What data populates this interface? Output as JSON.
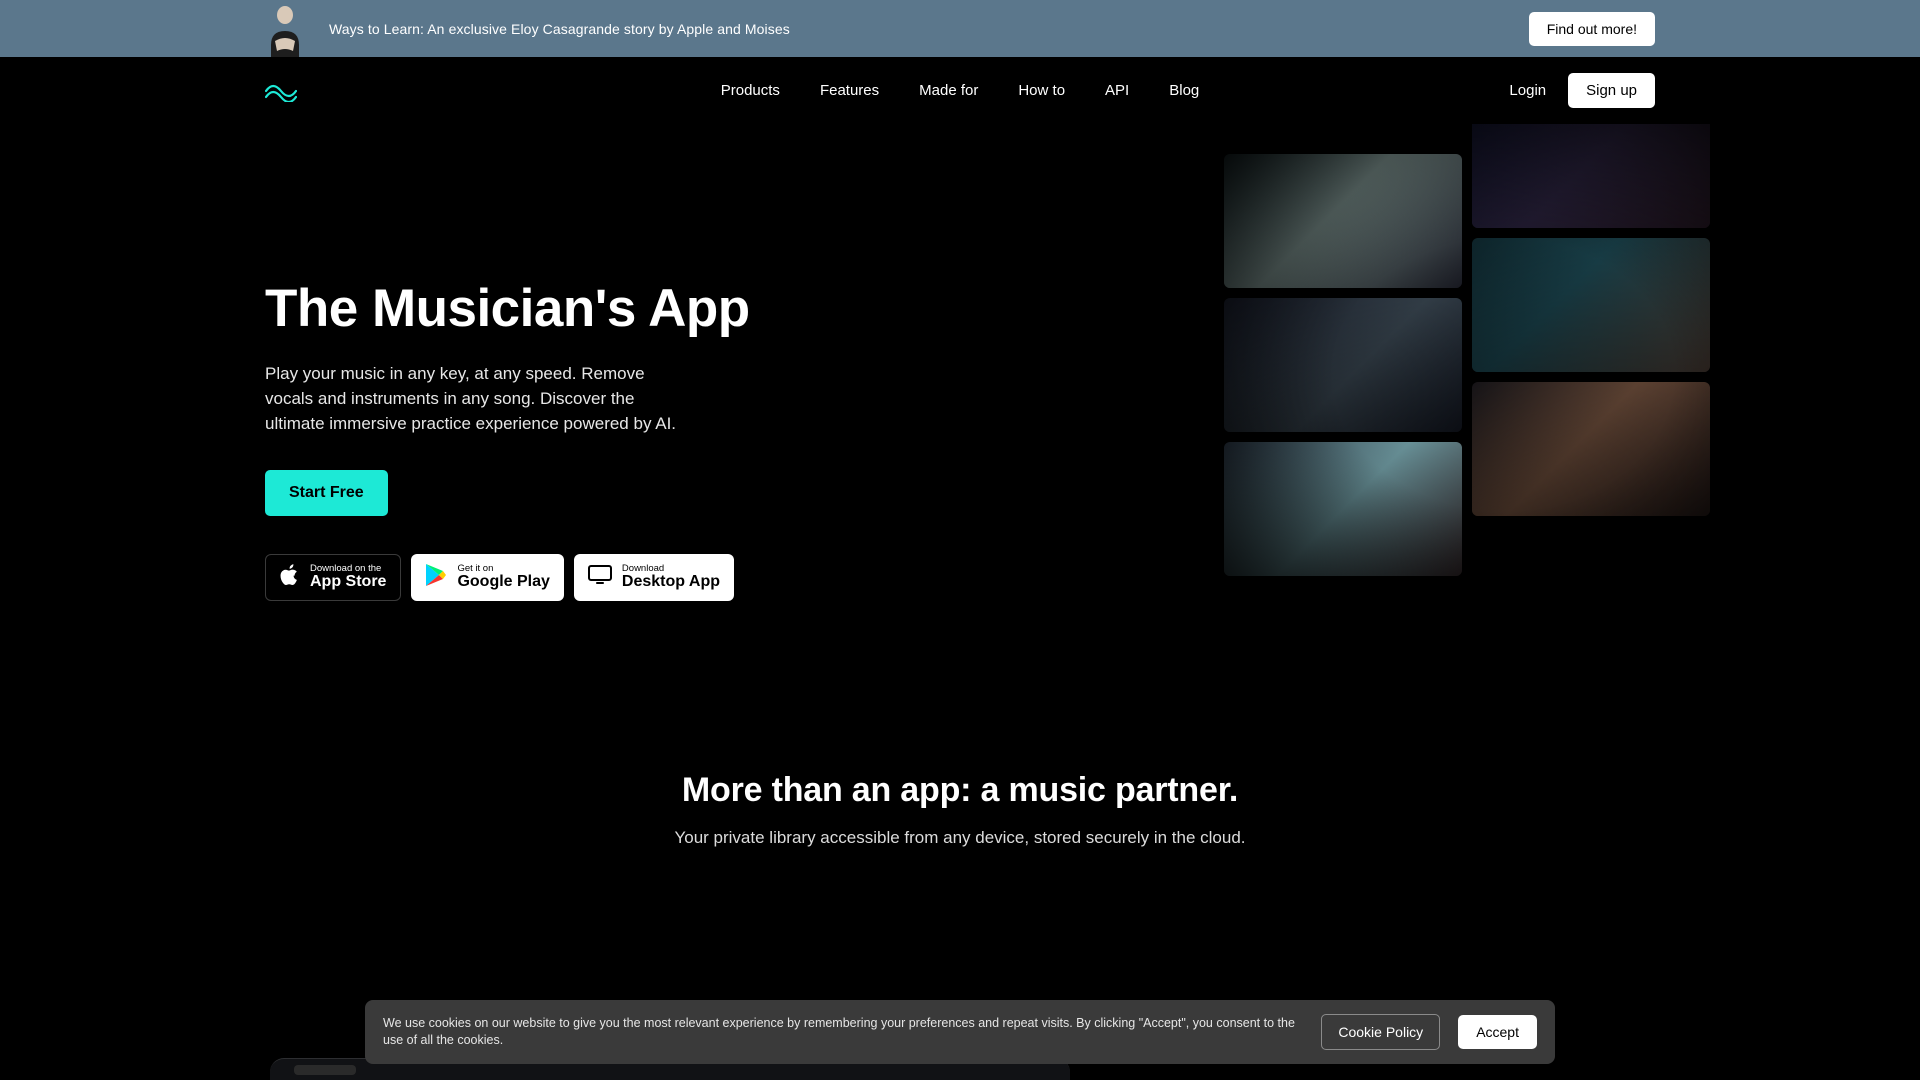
{
  "announce": {
    "text": "Ways to Learn: An exclusive Eloy Casagrande story by Apple and Moises",
    "cta": "Find out more!"
  },
  "nav": {
    "items": [
      "Products",
      "Features",
      "Made for",
      "How to",
      "API",
      "Blog"
    ],
    "login": "Login",
    "signup": "Sign up"
  },
  "hero": {
    "title": "The Musician's App",
    "desc": "Play your music in any key, at any speed. Remove vocals and instruments in any song. Discover the ultimate immersive practice experience powered by AI.",
    "cta": "Start Free"
  },
  "stores": {
    "appstore_small": "Download on the",
    "appstore_big": "App Store",
    "google_small": "Get it on",
    "google_big": "Google Play",
    "desktop_small": "Download",
    "desktop_big": "Desktop App"
  },
  "partner": {
    "title": "More than an app: a music partner.",
    "sub": "Your private library accessible from any device, stored securely in the cloud."
  },
  "cookies": {
    "text": "We use cookies on our website to give you the most relevant experience by remembering your preferences and repeat visits. By clicking \"Accept\", you consent to the use of all the cookies.",
    "policy": "Cookie Policy",
    "accept": "Accept"
  },
  "colors": {
    "accent": "#1de9d6",
    "banner": "#5b778c"
  }
}
